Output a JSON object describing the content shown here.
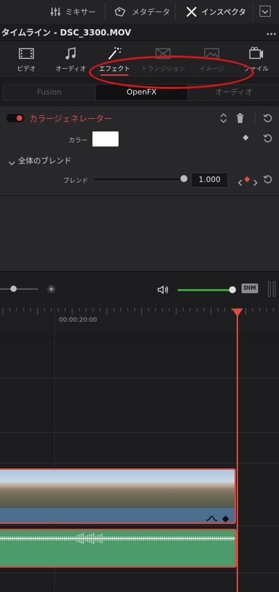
{
  "toolbar": {
    "mixer_label": "ミキサー",
    "metadata_label": "メタデータ",
    "inspector_label": "インスペクタ"
  },
  "clip_title": "タイムライン - DSC_3300.MOV",
  "categories": [
    {
      "label": "ビデオ",
      "icon": "film-icon"
    },
    {
      "label": "オーディオ",
      "icon": "music-note-icon"
    },
    {
      "label": "エフェクト",
      "icon": "magic-wand-icon"
    },
    {
      "label": "トランジション",
      "icon": "transition-icon"
    },
    {
      "label": "イメージ",
      "icon": "image-icon"
    },
    {
      "label": "ファイル",
      "icon": "file-icon"
    }
  ],
  "subtabs": [
    "Fusion",
    "OpenFX",
    "オーディオ"
  ],
  "effect": {
    "name": "カラージェネレーター",
    "color_label": "カラー",
    "color_value": "#ffffff",
    "section_label": "全体のブレンド",
    "blend_label": "ブレンド",
    "blend_value": "1.000"
  },
  "timeline": {
    "timecode": "00:00:20:00",
    "dim_label": "DIM"
  },
  "colors": {
    "accent": "#e04a3f",
    "audio_level": "#3ea23a",
    "audio_clip": "#4d9a6a",
    "video_clip": "#4a6f8f"
  }
}
